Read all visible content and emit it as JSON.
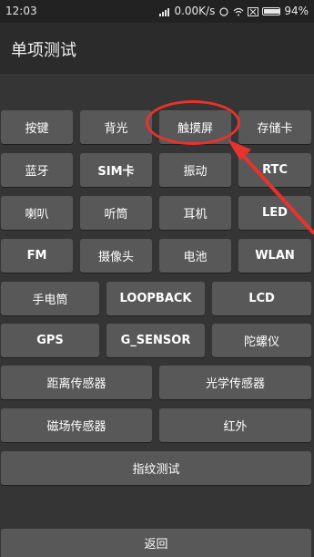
{
  "status": {
    "time": "12:03",
    "speed": "0.00K/s",
    "battery": "94%"
  },
  "title": "单项测试",
  "buttons": {
    "anjian": "按键",
    "beiguang": "背光",
    "chumoping": "触摸屏",
    "cunchuka": "存储卡",
    "lanya": "蓝牙",
    "simka": "SIM卡",
    "zhendong": "振动",
    "rtc": "RTC",
    "laba": "喇叭",
    "tingtong": "听筒",
    "erji": "耳机",
    "led": "LED",
    "fm": "FM",
    "shexiangtou": "摄像头",
    "dianchi": "电池",
    "wlan": "WLAN",
    "shoudiantong": "手电筒",
    "loopback": "LOOPBACK",
    "lcd": "LCD",
    "gps": "GPS",
    "gsensor": "G_SENSOR",
    "tuoluoyi": "陀螺仪",
    "juli": "距离传感器",
    "guangxue": "光学传感器",
    "cichang": "磁场传感器",
    "hongwai": "红外",
    "zhiwen": "指纹测试",
    "fanhui": "返回"
  },
  "accent_color": "#e8322d"
}
